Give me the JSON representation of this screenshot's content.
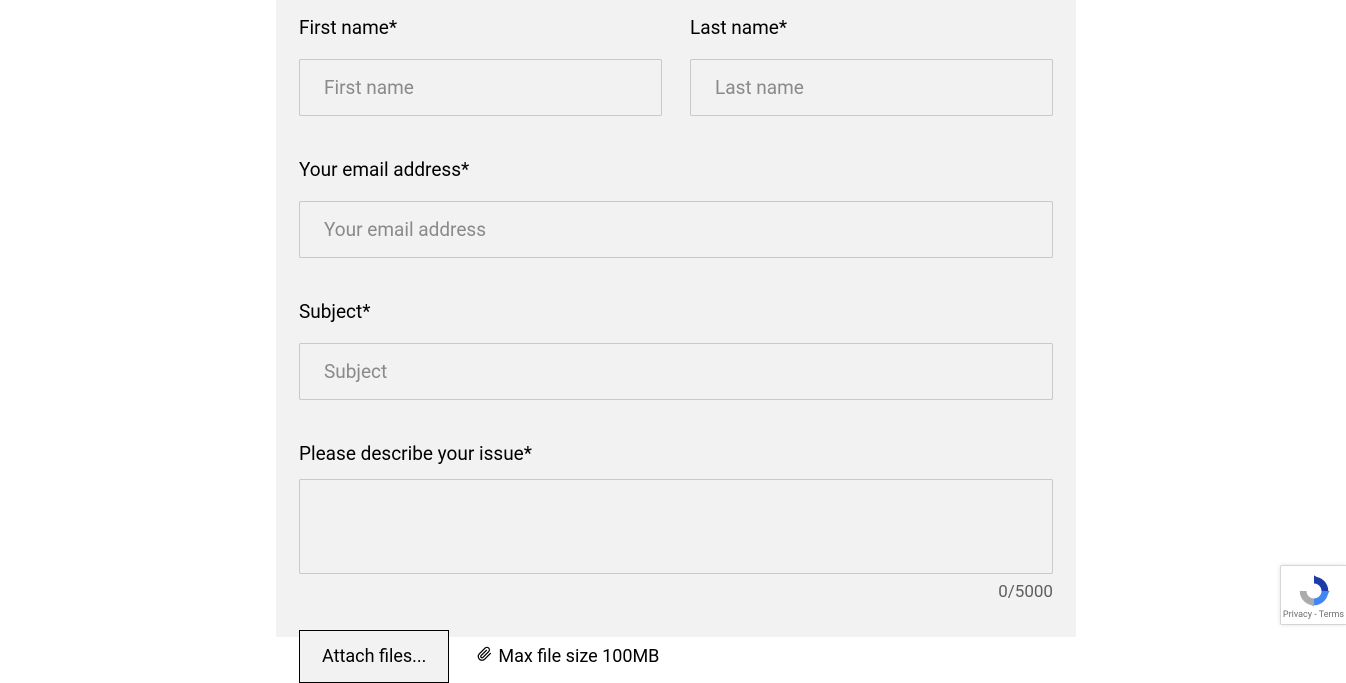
{
  "form": {
    "first_name": {
      "label": "First name*",
      "placeholder": "First name",
      "value": ""
    },
    "last_name": {
      "label": "Last name*",
      "placeholder": "Last name",
      "value": ""
    },
    "email": {
      "label": "Your email address*",
      "placeholder": "Your email address",
      "value": ""
    },
    "subject": {
      "label": "Subject*",
      "placeholder": "Subject",
      "value": ""
    },
    "issue": {
      "label": "Please describe your issue*",
      "value": "",
      "counter": "0/5000"
    },
    "attach": {
      "button_label": "Attach files...",
      "note": "Max file size 100MB"
    }
  },
  "recaptcha": {
    "privacy": "Privacy",
    "separator": " - ",
    "terms": "Terms"
  }
}
